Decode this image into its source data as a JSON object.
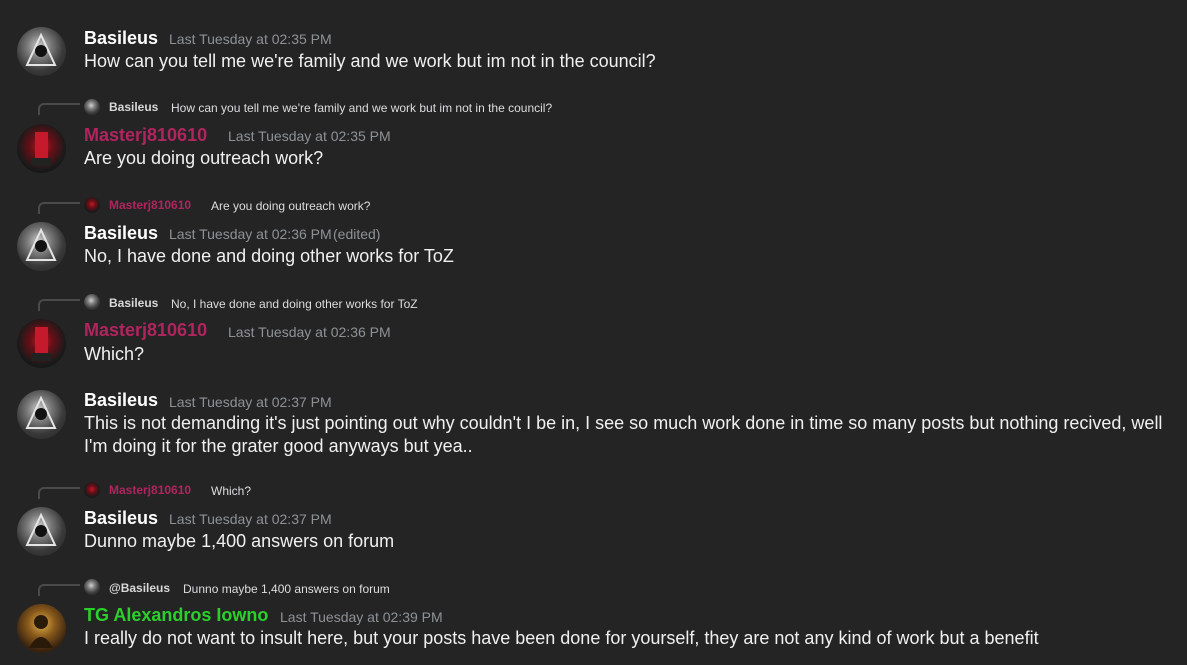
{
  "colors": {
    "background": "#242424",
    "basileus_name": "#ffffff",
    "masterj_name": "#b0245f",
    "tg_name": "#2bd12b",
    "timestamp": "#8e9297"
  },
  "messages": [
    {
      "author": "Basileus",
      "timestamp": "Last Tuesday at 02:35 PM",
      "text": "How can you tell me we're family and we work but im not in the council?",
      "avatar_icon": "user-avatar-icon"
    },
    {
      "reply": {
        "author": "Basileus",
        "text": "How can you tell me we're family and we work but im not in the council?"
      },
      "author": "Masterj810610",
      "timestamp": "Last Tuesday at 02:35 PM",
      "text": "Are you doing outreach work?",
      "avatar_icon": "user-avatar-icon"
    },
    {
      "reply": {
        "author": "Masterj810610",
        "text": "Are you doing outreach work?"
      },
      "author": "Basileus",
      "timestamp": "Last Tuesday at 02:36 PM",
      "edited": "(edited)",
      "text": "No, I have done and doing other works for ToZ",
      "avatar_icon": "user-avatar-icon"
    },
    {
      "reply": {
        "author": "Basileus",
        "text": "No, I have done and doing other works for ToZ"
      },
      "author": "Masterj810610",
      "timestamp": "Last Tuesday at 02:36 PM",
      "text": "Which?",
      "avatar_icon": "user-avatar-icon"
    },
    {
      "author": "Basileus",
      "timestamp": "Last Tuesday at 02:37 PM",
      "text": "This is not demanding it's just pointing out why couldn't I be in, I see so much work done in time so many posts but nothing recived, well I'm doing it for the grater good anyways but yea..",
      "avatar_icon": "user-avatar-icon"
    },
    {
      "reply": {
        "author": "Masterj810610",
        "text": "Which?"
      },
      "author": "Basileus",
      "timestamp": "Last Tuesday at 02:37 PM",
      "text": "Dunno maybe 1,400 answers on forum",
      "avatar_icon": "user-avatar-icon"
    },
    {
      "reply": {
        "author": "@Basileus",
        "text": "Dunno maybe 1,400 answers on forum"
      },
      "author": "TG Alexandros Iowno",
      "timestamp": "Last Tuesday at 02:39 PM",
      "text": "I really do not want to insult here, but your posts have been done for yourself, they are not any kind of work but a benefit",
      "avatar_icon": "user-avatar-icon"
    }
  ]
}
